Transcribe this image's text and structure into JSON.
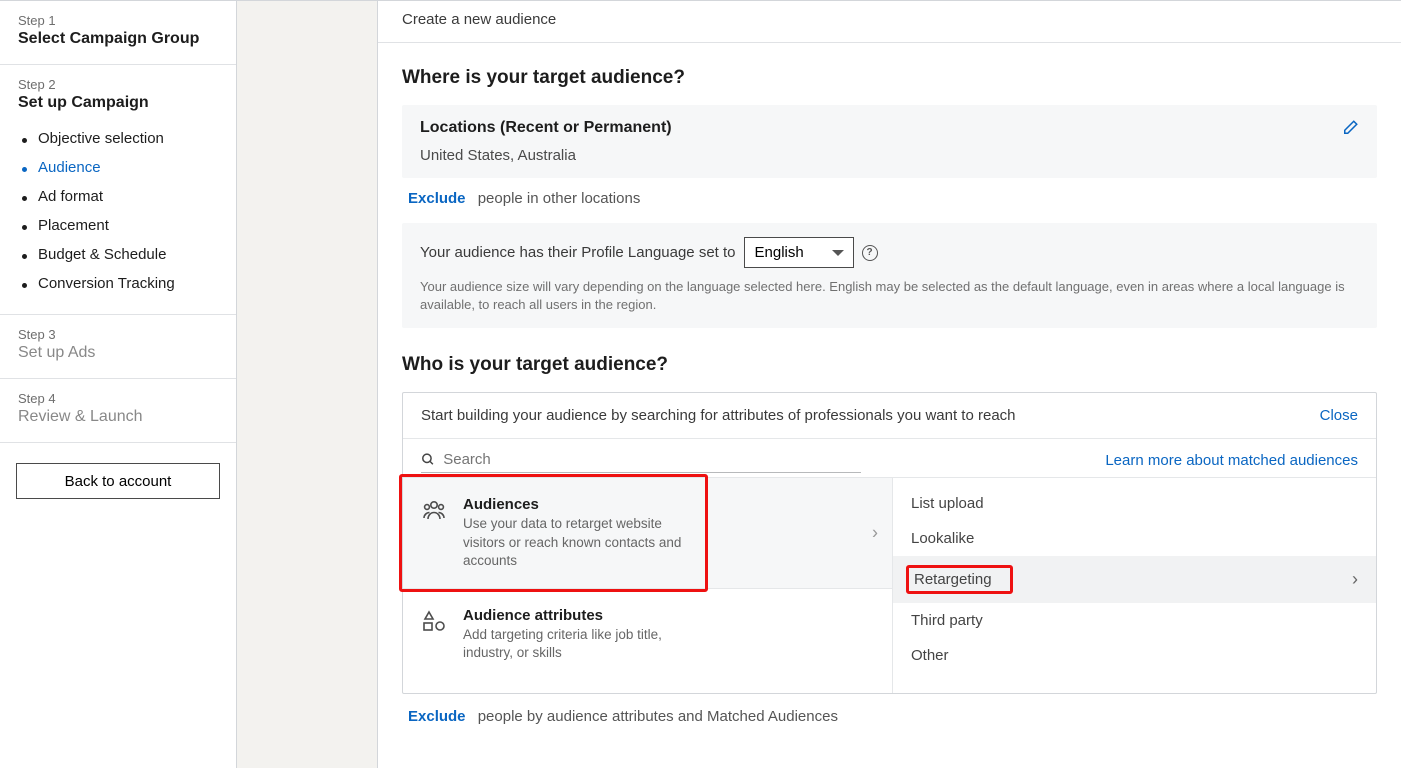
{
  "sidebar": {
    "steps": [
      {
        "label": "Step 1",
        "title": "Select Campaign Group"
      },
      {
        "label": "Step 2",
        "title": "Set up Campaign"
      },
      {
        "label": "Step 3",
        "title": "Set up Ads"
      },
      {
        "label": "Step 4",
        "title": "Review & Launch"
      }
    ],
    "substeps": [
      "Objective selection",
      "Audience",
      "Ad format",
      "Placement",
      "Budget & Schedule",
      "Conversion Tracking"
    ],
    "back_button": "Back to account"
  },
  "header": {
    "title": "Create a new audience"
  },
  "where": {
    "heading": "Where is your target audience?",
    "locations_title": "Locations (Recent or Permanent)",
    "locations_value": "United States, Australia",
    "exclude_label": "Exclude",
    "exclude_text": "people in other locations"
  },
  "language": {
    "prefix": "Your audience has their Profile Language set to",
    "selected": "English",
    "note": "Your audience size will vary depending on the language selected here. English may be selected as the default language, even in areas where a local language is available, to reach all users in the region."
  },
  "who": {
    "heading": "Who is your target audience?",
    "builder_intro": "Start building your audience by searching for attributes of professionals you want to reach",
    "close": "Close",
    "search_placeholder": "Search",
    "learn_link": "Learn more about matched audiences",
    "categories": [
      {
        "title": "Audiences",
        "desc": "Use your data to retarget website visitors or reach known contacts and accounts"
      },
      {
        "title": "Audience attributes",
        "desc": "Add targeting criteria like job title, industry, or skills"
      }
    ],
    "subitems": [
      "List upload",
      "Lookalike",
      "Retargeting",
      "Third party",
      "Other"
    ],
    "exclude_label": "Exclude",
    "exclude_text": "people by audience attributes and Matched Audiences"
  }
}
